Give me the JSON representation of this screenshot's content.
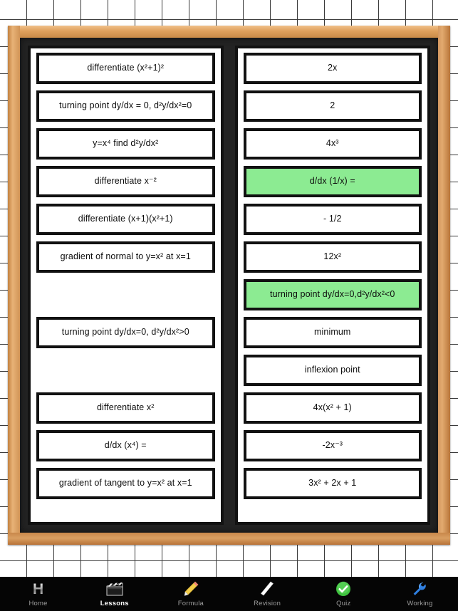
{
  "app": {
    "background": "squared-paper",
    "frame_color": "#c88a4c",
    "board_color": "#232323",
    "highlight_color": "#8ceb92"
  },
  "left_column": {
    "name": "questions-column",
    "slots": [
      {
        "text": "differentiate (x²+1)²",
        "empty": false,
        "highlight": false
      },
      {
        "text": "turning point dy/dx = 0, d²y/dx²=0",
        "empty": false,
        "highlight": false
      },
      {
        "text": "y=x⁴ find d²y/dx²",
        "empty": false,
        "highlight": false
      },
      {
        "text": "differentiate x⁻²",
        "empty": false,
        "highlight": false
      },
      {
        "text": "differentiate (x+1)(x²+1)",
        "empty": false,
        "highlight": false
      },
      {
        "text": "gradient of normal to y=x² at x=1",
        "empty": false,
        "highlight": false
      },
      {
        "text": "",
        "empty": true,
        "highlight": false
      },
      {
        "text": "turning point dy/dx=0, d²y/dx²>0",
        "empty": false,
        "highlight": false
      },
      {
        "text": "",
        "empty": true,
        "highlight": false
      },
      {
        "text": "differentiate x²",
        "empty": false,
        "highlight": false
      },
      {
        "text": "d/dx (x⁴) =",
        "empty": false,
        "highlight": false
      },
      {
        "text": "gradient of tangent to y=x² at x=1",
        "empty": false,
        "highlight": false
      }
    ]
  },
  "right_column": {
    "name": "answers-column",
    "slots": [
      {
        "text": "2x",
        "empty": false,
        "highlight": false
      },
      {
        "text": "2",
        "empty": false,
        "highlight": false
      },
      {
        "text": "4x³",
        "empty": false,
        "highlight": false
      },
      {
        "text": "d/dx (1/x) =",
        "empty": false,
        "highlight": true
      },
      {
        "text": "- 1/2",
        "empty": false,
        "highlight": false
      },
      {
        "text": "12x²",
        "empty": false,
        "highlight": false
      },
      {
        "text": "turning point dy/dx=0,d²y/dx²<0",
        "empty": false,
        "highlight": true
      },
      {
        "text": "minimum",
        "empty": false,
        "highlight": false
      },
      {
        "text": "inflexion point",
        "empty": false,
        "highlight": false
      },
      {
        "text": "4x(x² + 1)",
        "empty": false,
        "highlight": false
      },
      {
        "text": "-2x⁻³",
        "empty": false,
        "highlight": false
      },
      {
        "text": "3x² + 2x + 1",
        "empty": false,
        "highlight": false
      }
    ]
  },
  "tabbar": {
    "items": [
      {
        "label": "Home",
        "icon": "letter-h-icon",
        "active": false
      },
      {
        "label": "Lessons",
        "icon": "clapperboard-icon",
        "active": true
      },
      {
        "label": "Formula",
        "icon": "pencil-icon",
        "active": false
      },
      {
        "label": "Revision",
        "icon": "chalk-stick-icon",
        "active": false
      },
      {
        "label": "Quiz",
        "icon": "green-check-icon",
        "active": false
      },
      {
        "label": "Working",
        "icon": "blue-wrench-icon",
        "active": false
      }
    ]
  }
}
